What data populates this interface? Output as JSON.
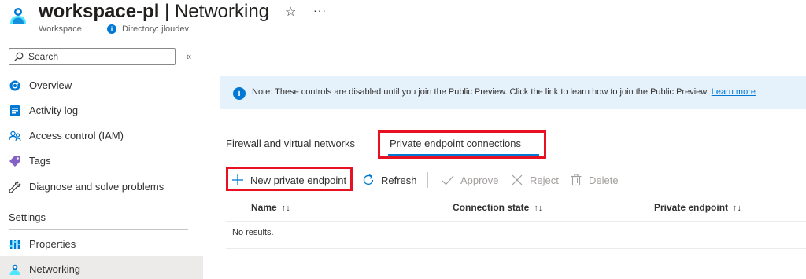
{
  "header": {
    "resource_name": "workspace-pl",
    "separator": " | ",
    "page_name": "Networking",
    "resource_type": "Workspace",
    "directory": "Directory: jloudev"
  },
  "sidebar": {
    "search_placeholder": "Search",
    "items": [
      {
        "label": "Overview",
        "icon": "overview-icon"
      },
      {
        "label": "Activity log",
        "icon": "activity-log-icon"
      },
      {
        "label": "Access control (IAM)",
        "icon": "iam-icon"
      },
      {
        "label": "Tags",
        "icon": "tag-icon"
      },
      {
        "label": "Diagnose and solve problems",
        "icon": "wrench-icon"
      }
    ],
    "section": "Settings",
    "settings_items": [
      {
        "label": "Properties",
        "icon": "properties-icon"
      },
      {
        "label": "Networking",
        "icon": "networking-icon",
        "active": true
      }
    ]
  },
  "banner": {
    "text": "Note: These controls are disabled until you join the Public Preview. Click the link to learn how to join the Public Preview.",
    "link": "Learn more"
  },
  "tabs": [
    {
      "label": "Firewall and virtual networks",
      "selected": false
    },
    {
      "label": "Private endpoint connections",
      "selected": true
    }
  ],
  "toolbar": {
    "new_label": "New private endpoint",
    "refresh_label": "Refresh",
    "approve_label": "Approve",
    "reject_label": "Reject",
    "delete_label": "Delete"
  },
  "table": {
    "columns": [
      "Name",
      "Connection state",
      "Private endpoint"
    ],
    "empty_text": "No results."
  },
  "colors": {
    "accent": "#0078d4",
    "highlight_box": "#e81123",
    "banner_bg": "#e6f2fb",
    "active_nav_bg": "#edebe9"
  }
}
